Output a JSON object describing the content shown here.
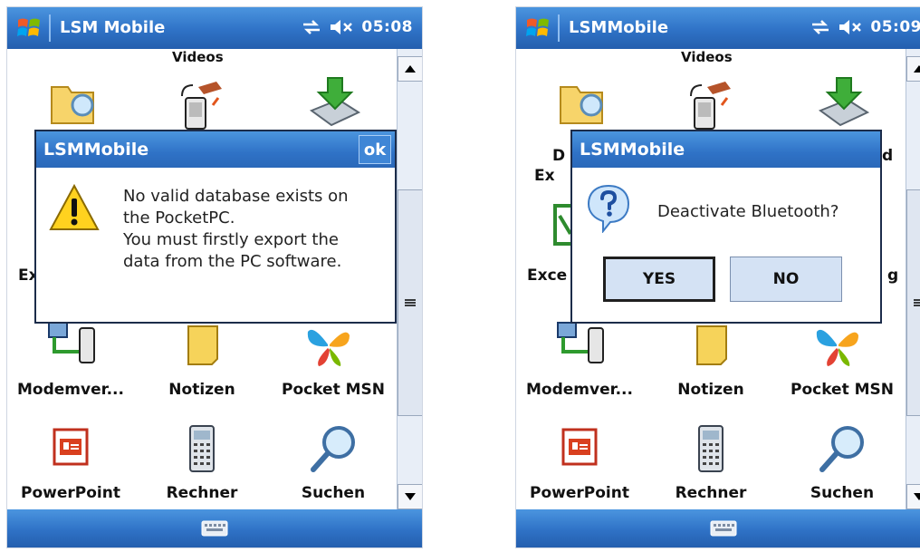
{
  "screens": [
    {
      "titlebar": {
        "title": "LSM Mobile",
        "time": "05:08"
      },
      "partial_top_label": "Videos",
      "grid": [
        {
          "label": "Modemver..."
        },
        {
          "label": "Notizen"
        },
        {
          "label": "Pocket MSN"
        },
        {
          "label": "PowerPoint"
        },
        {
          "label": "Rechner"
        },
        {
          "label": "Suchen"
        }
      ],
      "side_fragments": {
        "row2_left": "Ex"
      },
      "dialog": {
        "title": "LSMMobile",
        "ok_label": "ok",
        "message_lines": [
          "No valid database exists on",
          "the PocketPC.",
          "You must firstly export the",
          "data from the PC software."
        ],
        "icon": "warning-icon"
      }
    },
    {
      "titlebar": {
        "title": "LSMMobile",
        "time": "05:09"
      },
      "partial_top_label": "Videos",
      "grid": [
        {
          "label": "Modemver..."
        },
        {
          "label": "Notizen"
        },
        {
          "label": "Pocket MSN"
        },
        {
          "label": "PowerPoint"
        },
        {
          "label": "Rechner"
        },
        {
          "label": "Suchen"
        }
      ],
      "side_fragments": {
        "row1_left_a": "D",
        "row1_left_b": "Ex",
        "row1_right": "d",
        "row2_left": "Exce",
        "row2_right": "g"
      },
      "dialog": {
        "title": "LSMMobile",
        "question": "Deactivate Bluetooth?",
        "yes_label": "YES",
        "no_label": "NO",
        "icon": "question-icon"
      }
    }
  ],
  "colors": {
    "titlebar": "#2f72c6",
    "dialog_button": "#d4e2f4"
  }
}
